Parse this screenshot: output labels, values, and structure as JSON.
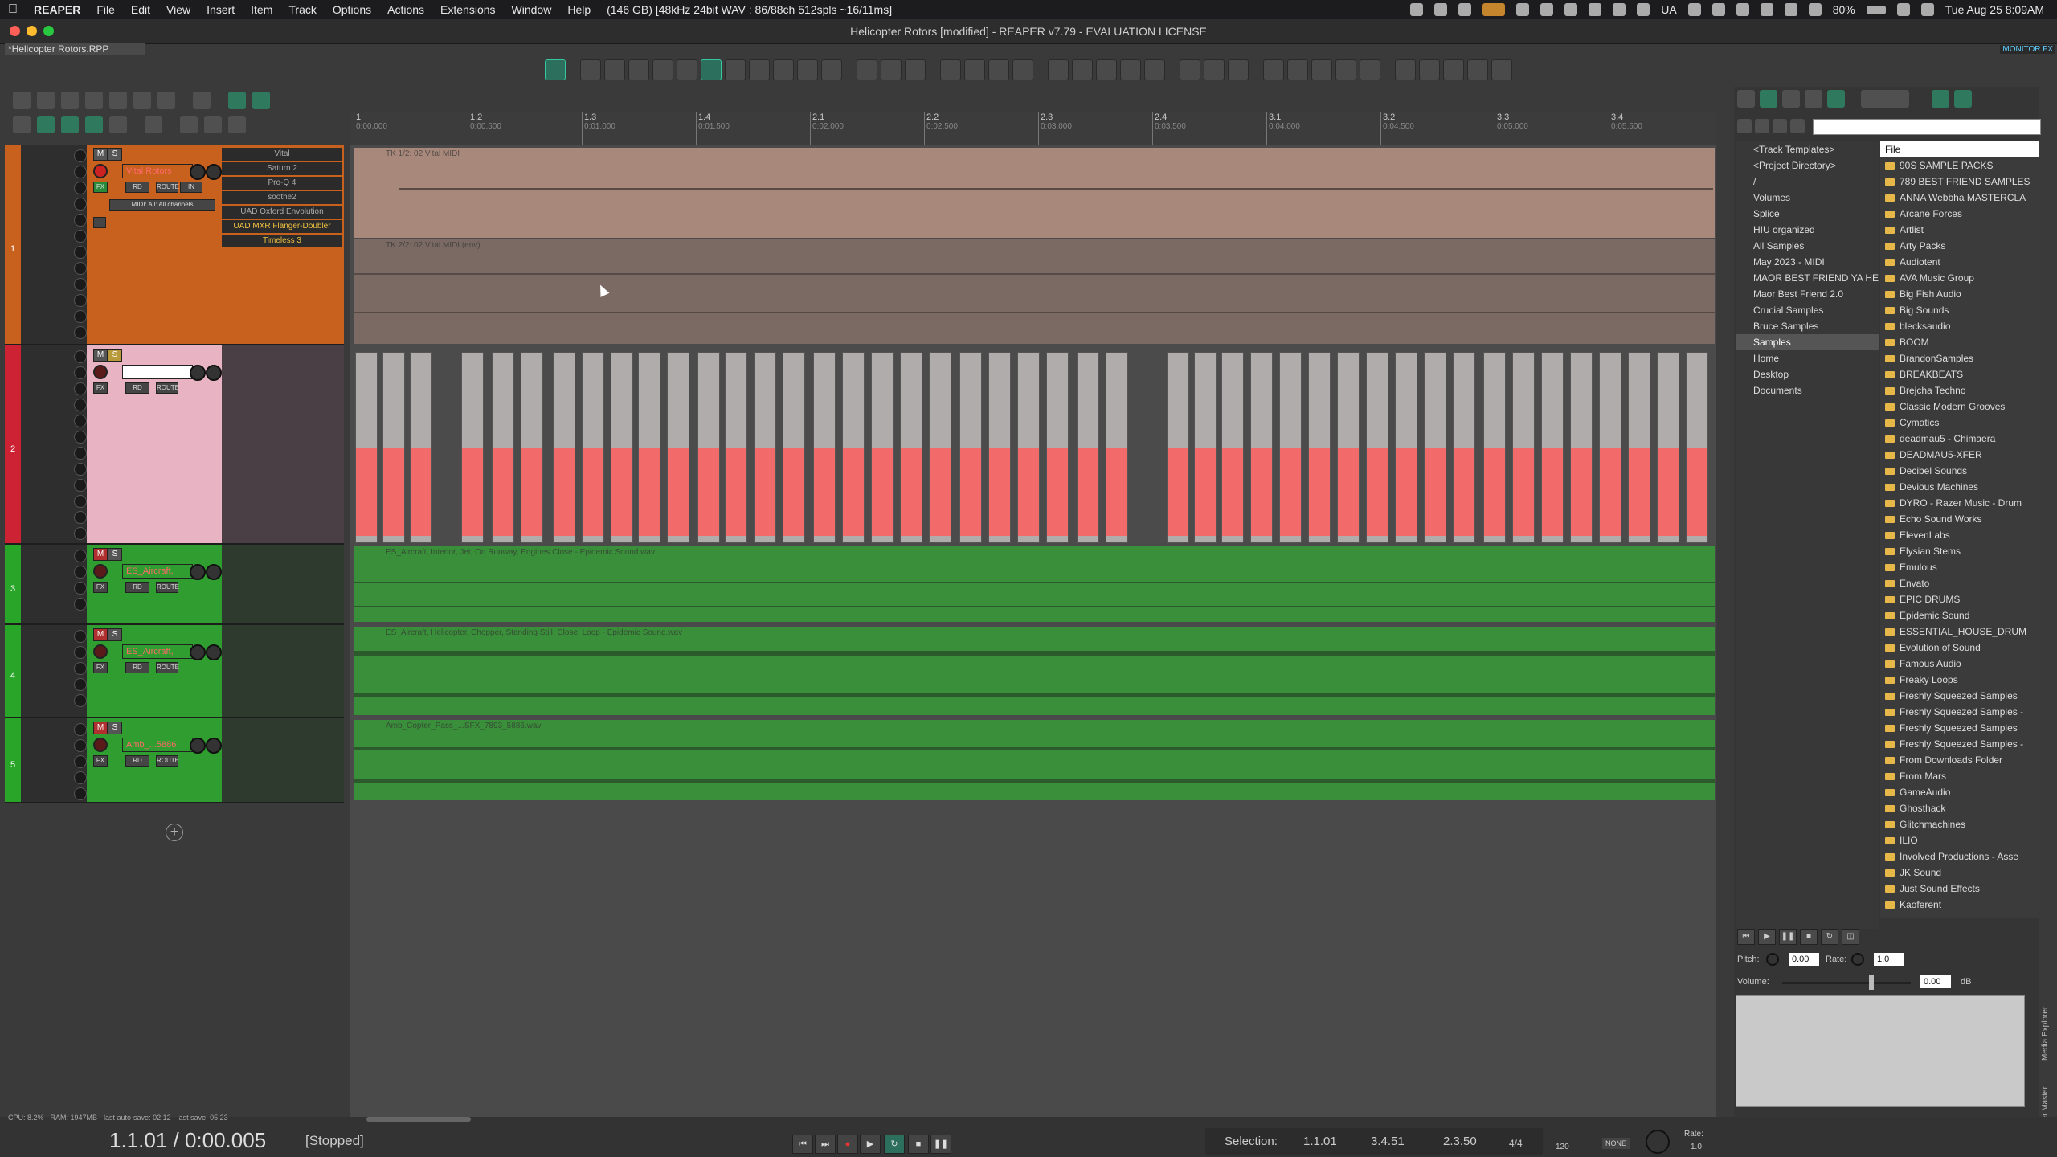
{
  "menubar": {
    "apple": "",
    "app": "REAPER",
    "items": [
      "File",
      "Edit",
      "View",
      "Insert",
      "Item",
      "Track",
      "Options",
      "Actions",
      "Extensions",
      "Window",
      "Help"
    ],
    "info": "(146 GB) [48kHz 24bit WAV : 86/88ch 512spls ~16/11ms]",
    "battery": "80%",
    "locale": "UA",
    "datetime": "Tue Aug 25  8:09AM"
  },
  "window": {
    "title": "Helicopter Rotors [modified] - REAPER v7.79 - EVALUATION LICENSE",
    "project_tab": "*Helicopter Rotors.RPP",
    "monitor_fx": "MONITOR FX"
  },
  "ruler": {
    "marks": [
      {
        "bar": "1",
        "time": "0:00.000"
      },
      {
        "bar": "1.2",
        "time": "0:00.500"
      },
      {
        "bar": "1.3",
        "time": "0:01.000"
      },
      {
        "bar": "1.4",
        "time": "0:01.500"
      },
      {
        "bar": "2.1",
        "time": "0:02.000"
      },
      {
        "bar": "2.2",
        "time": "0:02.500"
      },
      {
        "bar": "2.3",
        "time": "0:03.000"
      },
      {
        "bar": "2.4",
        "time": "0:03.500"
      },
      {
        "bar": "3.1",
        "time": "0:04.000"
      },
      {
        "bar": "3.2",
        "time": "0:04.500"
      },
      {
        "bar": "3.3",
        "time": "0:05.000"
      },
      {
        "bar": "3.4",
        "time": "0:05.500"
      }
    ]
  },
  "tracks": [
    {
      "num": "1",
      "name": "Vital Rotors",
      "color": "#c8601e",
      "fx": [
        "Vital",
        "Saturn 2",
        "Pro-Q 4",
        "soothe2",
        "UAD Oxford Envolution",
        "UAD MXR Flanger-Doubler",
        "Timeless 3"
      ],
      "input": "IN",
      "midi_input": "MIDI: All: All channels",
      "item_label": "TK 1/2: 02 Vital MIDI",
      "item_label2": "TK 2/2: 02 Vital MIDI (env)"
    },
    {
      "num": "2",
      "name": "",
      "color": "#e8a8b8"
    },
    {
      "num": "3",
      "name": "ES_Aircraft,",
      "color": "#29a629",
      "item_label": "ES_Aircraft, Interior, Jet, On Runway, Engines Close - Epidemic Sound.wav"
    },
    {
      "num": "4",
      "name": "ES_Aircraft,",
      "color": "#29a629",
      "item_label": "ES_Aircraft, Helicopter, Chopper, Standing Still, Close, Loop - Epidemic Sound.wav"
    },
    {
      "num": "5",
      "name": "Amb_...5886",
      "color": "#29a629",
      "item_label": "Amb_Copter_Pass_...SFX_7893_5886.wav"
    }
  ],
  "tcp_labels": {
    "mute": "M",
    "solo": "S",
    "fx": "FX",
    "route": "ROUTE",
    "rd": "RD"
  },
  "media_explorer": {
    "dirs": [
      "<Track Templates>",
      "<Project Directory>",
      "/",
      "Volumes",
      "Splice",
      "HIU organized",
      "All Samples",
      "May 2023 - MIDI",
      "MAOR BEST FRIEND YA HE",
      "Maor Best Friend 2.0",
      "Crucial Samples",
      "Bruce Samples",
      "Samples",
      "Home",
      "Desktop",
      "Documents"
    ],
    "selected_dir": "Samples",
    "file_header": "File",
    "files": [
      "90S SAMPLE PACKS",
      "789 BEST FRIEND SAMPLES",
      "ANNA Webbha MASTERCLA",
      "Arcane Forces",
      "Artlist",
      "Arty Packs",
      "Audiotent",
      "AVA Music Group",
      "Big Fish Audio",
      "Big Sounds",
      "blecksaudio",
      "BOOM",
      "BrandonSamples",
      "BREAKBEATS",
      "Brejcha Techno",
      "Classic Modern Grooves",
      "Cymatics",
      "deadmau5 - Chimaera",
      "DEADMAU5-XFER",
      "Decibel Sounds",
      "Devious Machines",
      "DYRO - Razer Music - Drum",
      "Echo Sound Works",
      "ElevenLabs",
      "Elysian Stems",
      "Emulous",
      "Envato",
      "EPIC DRUMS",
      "Epidemic Sound",
      "ESSENTIAL_HOUSE_DRUM",
      "Evolution of Sound",
      "Famous Audio",
      "Freaky Loops",
      "Freshly Squeezed Samples",
      "Freshly Squeezed Samples -",
      "Freshly Squeezed Samples",
      "Freshly Squeezed Samples -",
      "From Downloads Folder",
      "From Mars",
      "GameAudio",
      "Ghosthack",
      "Glitchmachines",
      "ILIO",
      "Involved Productions - Asse",
      "JK Sound",
      "Just Sound Effects",
      "Kaoferent"
    ],
    "pitch_label": "Pitch:",
    "pitch_value": "0.00",
    "rate_label": "Rate:",
    "rate_value": "1.0",
    "volume_label": "Volume:",
    "volume_value": "0.00",
    "volume_unit": "dB",
    "side_tabs": [
      "Media Explorer",
      "Mixer Master"
    ]
  },
  "transport": {
    "perf": "CPU: 8.2% - RAM: 1947MB - last auto-save: 02:12 - last save: 05:23",
    "time": "1.1.01 / 0:00.005",
    "state": "[Stopped]",
    "selection_label": "Selection:",
    "sel_start": "1.1.01",
    "sel_end": "3.4.51",
    "sel_len": "2.3.50",
    "timesig": "4/4",
    "bpm": "120",
    "none": "NONE",
    "rate_label": "Rate:",
    "rate_value": "1.0"
  }
}
